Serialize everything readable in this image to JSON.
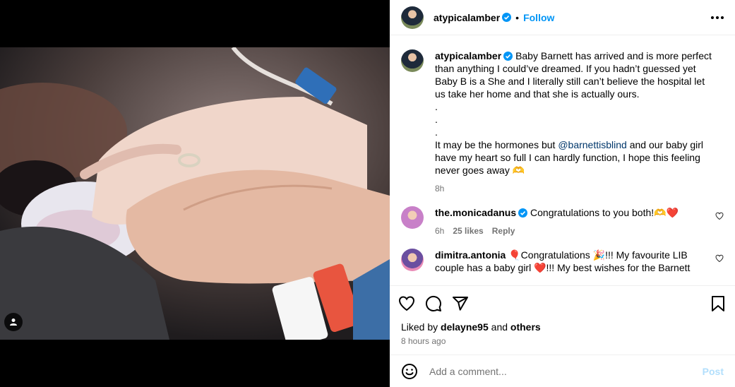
{
  "post": {
    "username": "atypicalamber",
    "follow_label": "Follow",
    "caption_lines": [
      "Baby Barnett has arrived and is more perfect than anything I could’ve dreamed. If you hadn’t guessed yet Baby B is a She and I literally still can’t believe the hospital let us take her home and that she is actually ours.",
      ".",
      ".",
      "."
    ],
    "caption_part2_before": "It may be the hormones but ",
    "caption_mention": "@barnettisblind",
    "caption_part2_after": " and our baby girl have my heart so full I can hardly function, I hope this feeling never goes away 🫶",
    "caption_time": "8h"
  },
  "comments": [
    {
      "username": "the.monicadanus",
      "text": "Congratulations to you both!🫶❤️",
      "time": "6h",
      "likes": "25 likes",
      "reply": "Reply"
    },
    {
      "username": "dimitra.antonia",
      "text": "🎈Congratulations 🎉!!! My favourite LIB couple has a baby girl ❤️!!! My best wishes for the Barnett",
      "time": "",
      "likes": "",
      "reply": ""
    }
  ],
  "likes_line": {
    "prefix": "Liked by ",
    "user": "delayne95",
    "middle": " and ",
    "others": "others"
  },
  "time_ago": "8 hours ago",
  "add_comment": {
    "placeholder": "Add a comment...",
    "post_label": "Post"
  },
  "icons": {
    "like": "heart-icon",
    "comment": "comment-icon",
    "share": "share-icon",
    "save": "bookmark-icon",
    "emoji": "emoji-icon",
    "more": "more-options-icon",
    "user_tag": "user-tag-icon",
    "verified": "verified-badge-icon"
  },
  "colors": {
    "accent": "#0095f6",
    "muted": "#737373",
    "mention": "#00376b",
    "post_disabled": "#b2dffc"
  }
}
